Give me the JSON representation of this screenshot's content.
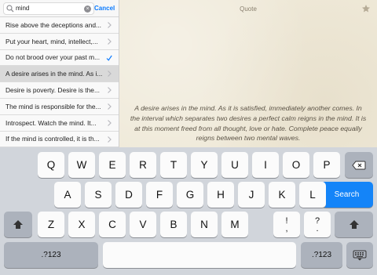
{
  "search": {
    "value": "mind",
    "cancel_label": "Cancel"
  },
  "results": [
    {
      "text": "Rise above the deceptions and...",
      "mark": "chevron"
    },
    {
      "text": "Put your heart, mind, intellect,...",
      "mark": "chevron"
    },
    {
      "text": "Do not brood over your past m...",
      "mark": "check"
    },
    {
      "text": "A desire arises in the mind. As i...",
      "mark": "chevron",
      "selected": true
    },
    {
      "text": "Desire is poverty. Desire is the...",
      "mark": "chevron"
    },
    {
      "text": "The mind is responsible for the...",
      "mark": "chevron"
    },
    {
      "text": "Introspect. Watch the mind. It...",
      "mark": "chevron"
    },
    {
      "text": "If the mind is controlled, it is th...",
      "mark": "chevron"
    }
  ],
  "quote": {
    "title": "Quote",
    "text": "A desire arises in the mind. As it is satisfied, immediately another comes. In the interval which separates two desires a perfect calm reigns in the mind. It is at this moment freed from all thought, love or hate. Complete peace equally reigns between two mental waves."
  },
  "keyboard": {
    "row1": [
      "Q",
      "W",
      "E",
      "R",
      "T",
      "Y",
      "U",
      "I",
      "O",
      "P"
    ],
    "row2": [
      "A",
      "S",
      "D",
      "F",
      "G",
      "H",
      "J",
      "K",
      "L"
    ],
    "row3": [
      "Z",
      "X",
      "C",
      "V",
      "B",
      "N",
      "M"
    ],
    "punct1": {
      "top": "!",
      "bottom": ","
    },
    "punct2": {
      "top": "?",
      "bottom": "."
    },
    "search_label": "Search",
    "numbers_label": ".?123"
  },
  "colors": {
    "accent": "#0a7aff",
    "search_key": "#1484f8",
    "quote_bg": "#efe9d8"
  },
  "icons": [
    "search-icon",
    "clear-icon",
    "chevron-right-icon",
    "checkmark-icon",
    "star-icon",
    "backspace-icon",
    "shift-icon",
    "keyboard-dismiss-icon"
  ]
}
